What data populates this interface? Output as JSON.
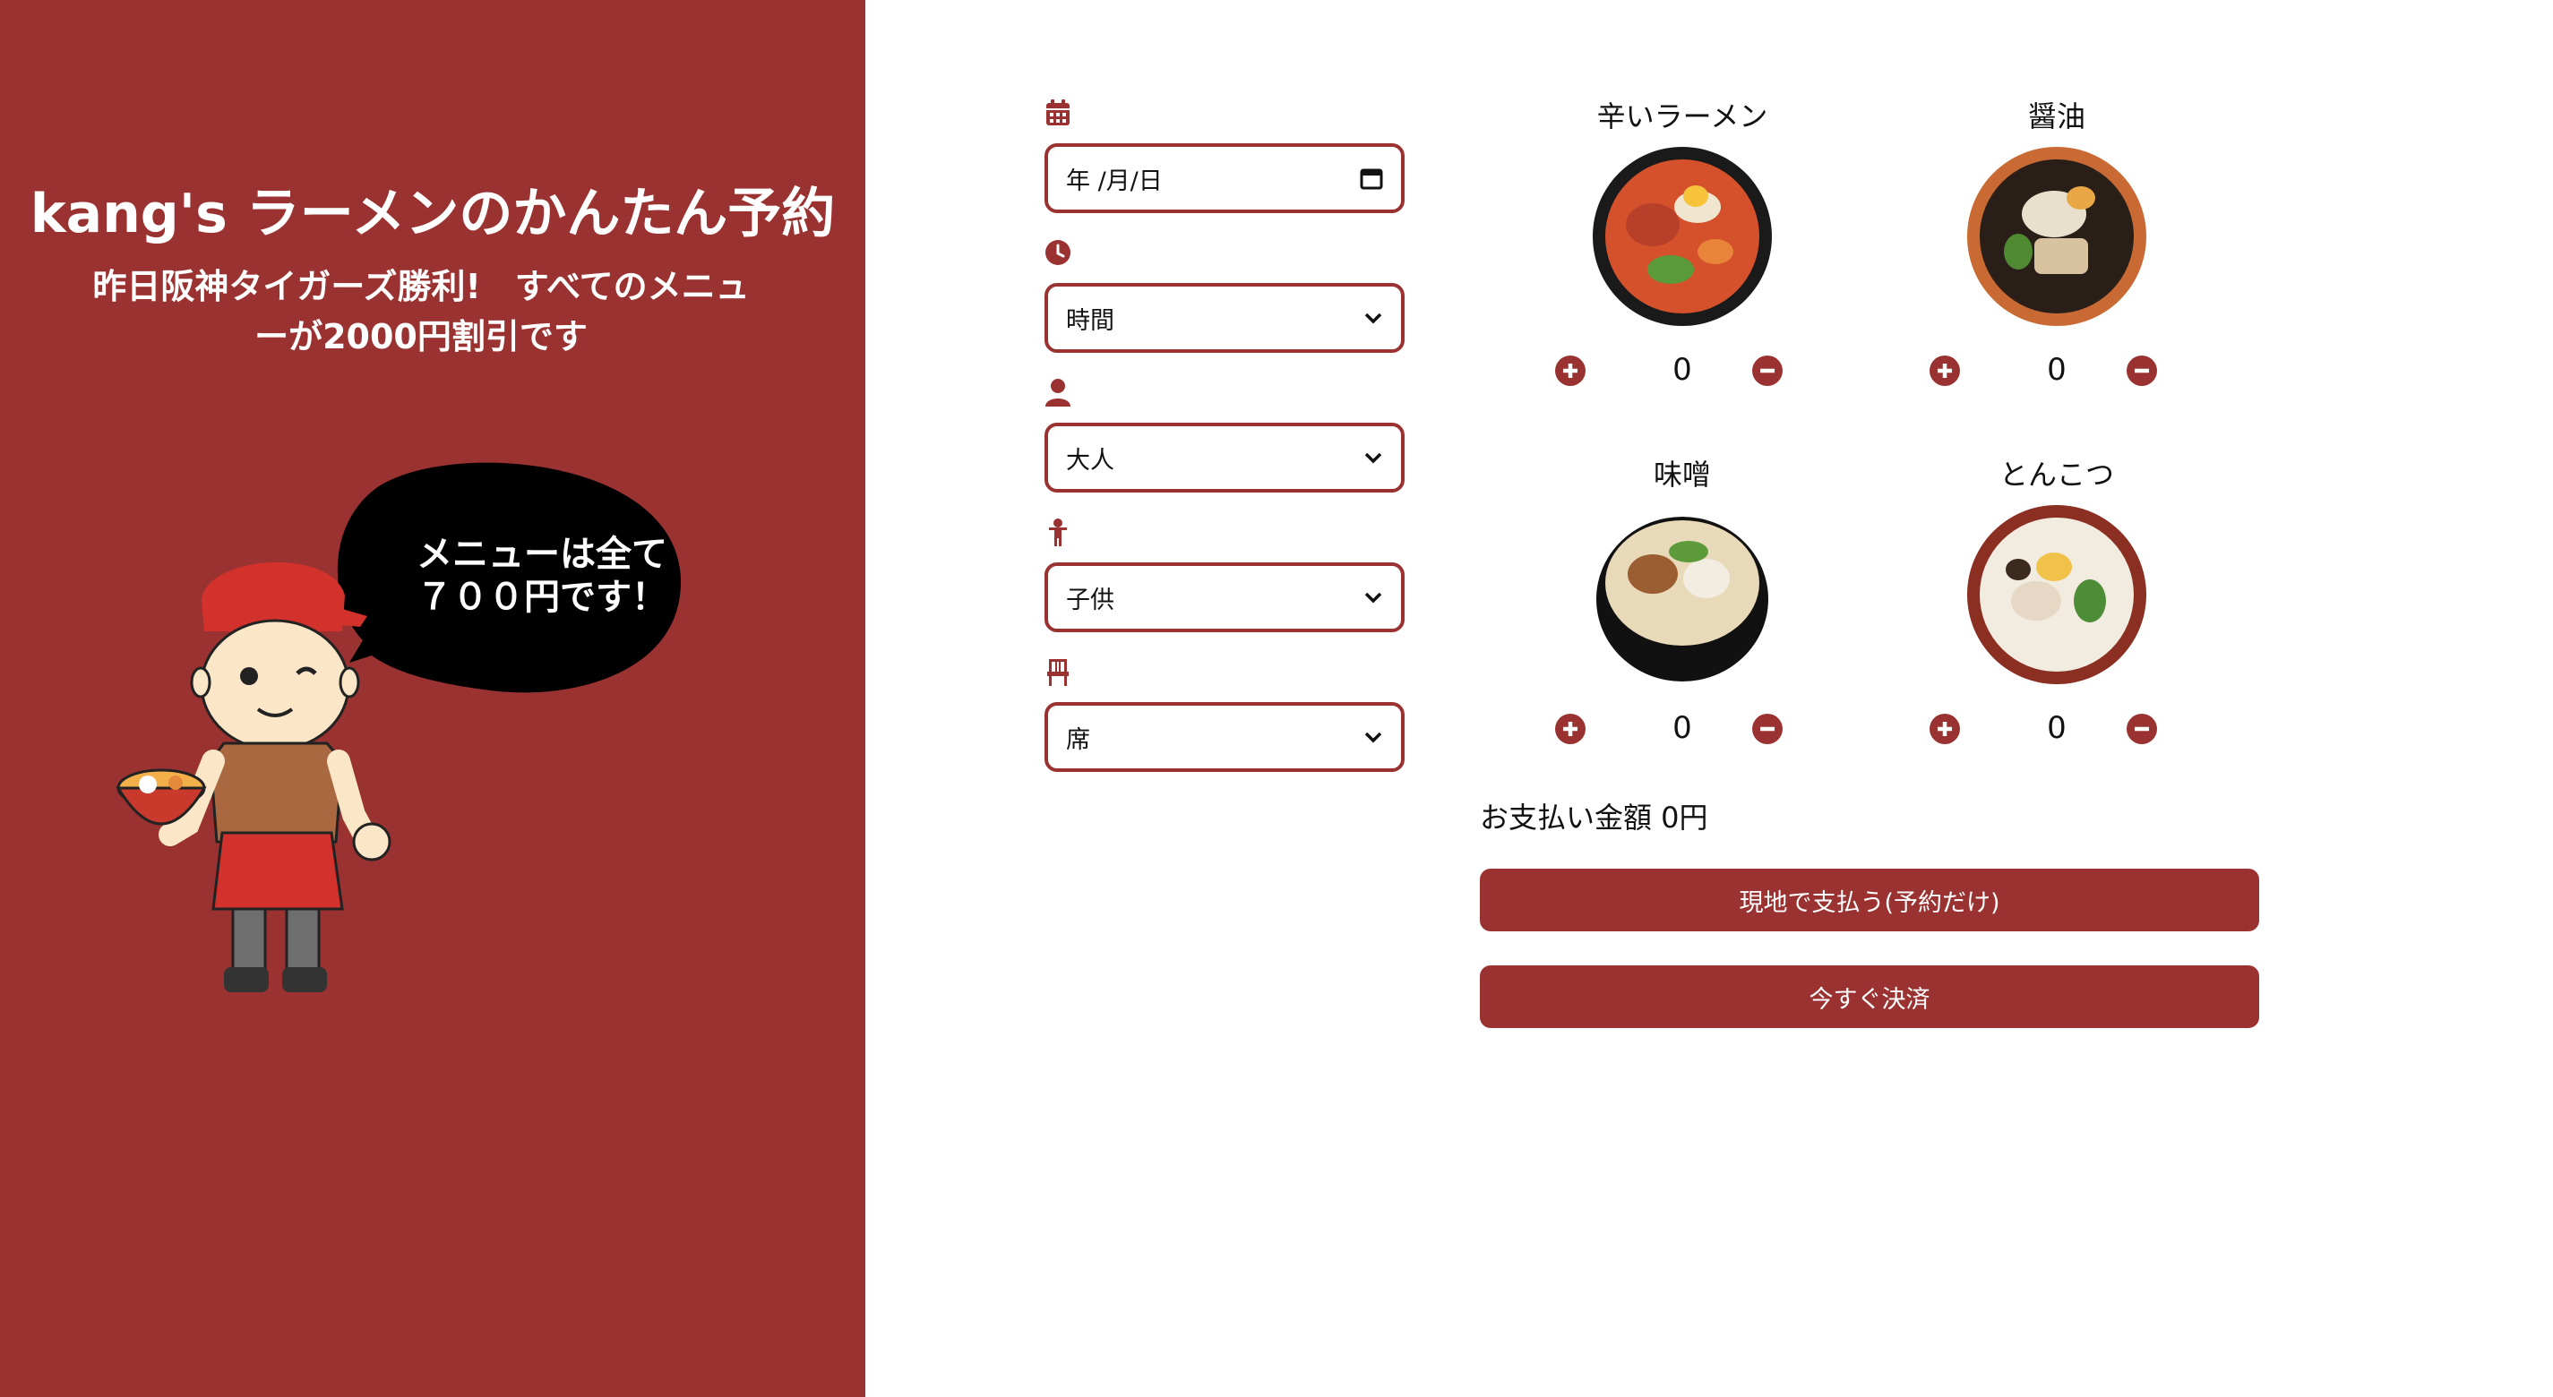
{
  "left": {
    "title": "kang's ラーメンのかんたん予約",
    "subtitle": "昨日阪神タイガーズ勝利!　すべてのメニューが2000円割引です",
    "bubble_line1": "メニューは全て",
    "bubble_line2": "７００円です！"
  },
  "form": {
    "date_value": "年 /月/日",
    "time_value": "時間",
    "adult_value": "大人",
    "child_value": "子供",
    "seat_value": "席",
    "icons": [
      "calendar-icon",
      "clock-icon",
      "person-icon",
      "child-icon",
      "chair-icon"
    ]
  },
  "menu": {
    "items": [
      {
        "name": "辛いラーメン",
        "qty": "0"
      },
      {
        "name": "醤油",
        "qty": "0"
      },
      {
        "name": "味噌",
        "qty": "0"
      },
      {
        "name": "とんこつ",
        "qty": "0"
      }
    ]
  },
  "payment": {
    "total_label": "お支払い金額 0円",
    "pay_on_site": "現地で支払う(予約だけ)",
    "pay_now": "今すぐ決済"
  },
  "colors": {
    "accent": "#993230",
    "background": "#ffffff"
  }
}
